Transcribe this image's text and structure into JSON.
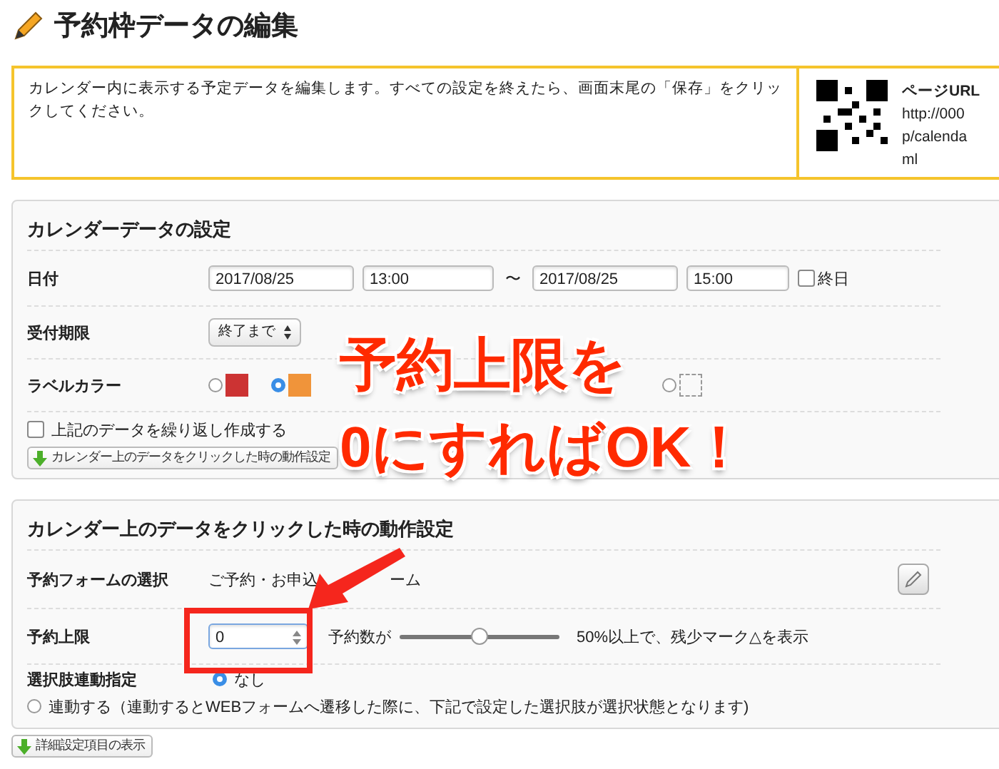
{
  "header": {
    "title": "予約枠データの編集"
  },
  "notice": {
    "text": "カレンダー内に表示する予定データを編集します。すべての設定を終えたら、画面末尾の「保存」をクリックしてください。",
    "url_label": "ページURL",
    "url_lines": [
      "http://000",
      "p/calenda",
      "ml"
    ]
  },
  "calendar_settings": {
    "title": "カレンダーデータの設定",
    "date": {
      "label": "日付",
      "start_date": "2017/08/25",
      "start_time": "13:00",
      "separator": "〜",
      "end_date": "2017/08/25",
      "end_time": "15:00",
      "all_day": {
        "label": "終日",
        "checked": false
      }
    },
    "deadline": {
      "label": "受付期限",
      "value": "終了まで"
    },
    "label_color": {
      "label": "ラベルカラー",
      "options": [
        {
          "kind": "swatch",
          "color": "#cc3333",
          "selected": false
        },
        {
          "kind": "swatch",
          "color": "#f0943a",
          "selected": true
        },
        {
          "kind": "none",
          "selected": false
        }
      ]
    },
    "repeat": {
      "label": "上記のデータを繰り返し作成する",
      "checked": false
    },
    "jump_button": "カレンダー上のデータをクリックした時の動作設定"
  },
  "click_settings": {
    "title": "カレンダー上のデータをクリックした時の動作設定",
    "form": {
      "label": "予約フォームの選択",
      "value_parts": [
        "ご予約・お申込",
        "ーム"
      ]
    },
    "limit": {
      "label": "予約上限",
      "value": "0",
      "prefix": "予約数が",
      "slider": {
        "level": 0.5
      },
      "suffix": "50%以上で、残少マーク△を表示"
    },
    "link": {
      "label": "選択肢連動指定",
      "options": [
        {
          "label": "なし",
          "selected": true
        },
        {
          "label": "連動する（連動するとWEBフォームへ遷移した際に、下記で設定した選択肢が選択状態となります)",
          "selected": false
        }
      ]
    }
  },
  "detail_button": "詳細設定項目の表示",
  "annotation": {
    "lines": [
      "予約上限を",
      "0にすればOK！"
    ]
  }
}
